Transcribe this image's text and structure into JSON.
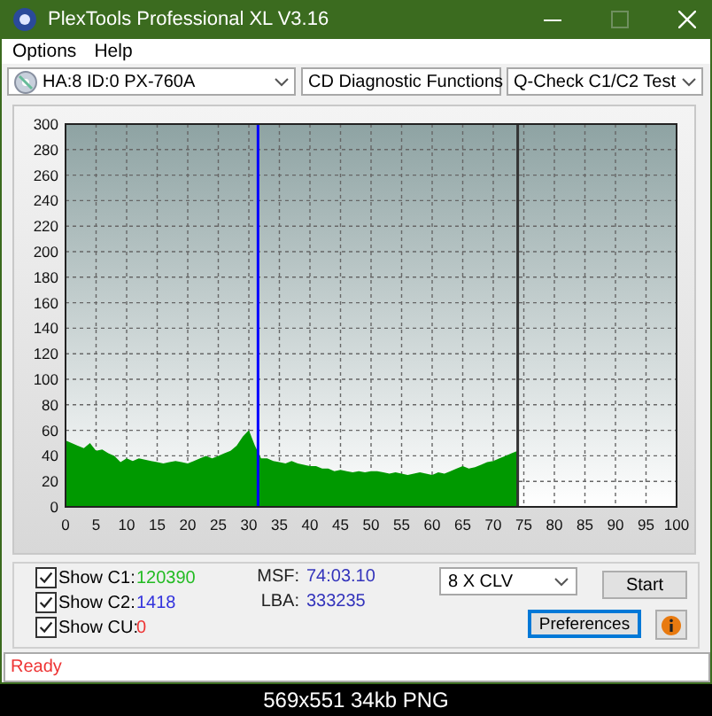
{
  "window": {
    "title": "PlexTools Professional XL V3.16"
  },
  "menu": [
    {
      "label": "Options"
    },
    {
      "label": "Help"
    }
  ],
  "toolbar": {
    "drive": "HA:8 ID:0  PX-760A",
    "function": "CD Diagnostic Functions",
    "test": "Q-Check C1/C2 Test"
  },
  "chart_data": {
    "type": "area",
    "x": [
      0,
      1,
      2,
      3,
      4,
      5,
      6,
      7,
      8,
      9,
      10,
      11,
      12,
      13,
      14,
      15,
      16,
      17,
      18,
      19,
      20,
      21,
      22,
      23,
      24,
      25,
      26,
      27,
      28,
      29,
      30,
      31,
      32,
      33,
      34,
      35,
      36,
      37,
      38,
      39,
      40,
      41,
      42,
      43,
      44,
      45,
      46,
      47,
      48,
      49,
      50,
      51,
      52,
      53,
      54,
      55,
      56,
      57,
      58,
      59,
      60,
      61,
      62,
      63,
      64,
      65,
      66,
      67,
      68,
      69,
      70,
      71,
      72,
      73,
      74
    ],
    "series": [
      {
        "color": "#009900",
        "values": [
          52,
          50,
          48,
          46,
          50,
          44,
          45,
          42,
          40,
          35,
          38,
          36,
          38,
          37,
          36,
          35,
          34,
          35,
          36,
          35,
          34,
          36,
          38,
          40,
          38,
          40,
          42,
          44,
          48,
          55,
          60,
          48,
          38,
          38,
          36,
          35,
          34,
          36,
          34,
          33,
          32,
          32,
          30,
          30,
          28,
          29,
          28,
          27,
          28,
          27,
          28,
          28,
          27,
          26,
          27,
          26,
          25,
          26,
          27,
          26,
          25,
          27,
          26,
          28,
          30,
          32,
          30,
          31,
          33,
          35,
          36,
          38,
          40,
          42,
          44
        ]
      }
    ],
    "xlim": [
      0,
      100
    ],
    "ylim": [
      0,
      300
    ],
    "xticks": [
      0,
      5,
      10,
      15,
      20,
      25,
      30,
      35,
      40,
      45,
      50,
      55,
      60,
      65,
      70,
      75,
      80,
      85,
      90,
      95,
      100
    ],
    "yticks": [
      0,
      20,
      40,
      60,
      80,
      100,
      120,
      140,
      160,
      180,
      200,
      220,
      240,
      260,
      280,
      300
    ],
    "grid": true,
    "ref_lines": [
      {
        "axis": "x",
        "value": 31.5,
        "color": "#0000ff"
      },
      {
        "axis": "x",
        "value": 74,
        "color": "#333333"
      }
    ]
  },
  "counters": [
    {
      "label": "Show C1:",
      "checked": true,
      "value": "120390",
      "color": "#22bb22"
    },
    {
      "label": "Show C2:",
      "checked": true,
      "value": "1418",
      "color": "#3333dd"
    },
    {
      "label": "Show CU:",
      "checked": true,
      "value": "0",
      "color": "#ee3333"
    }
  ],
  "position": [
    {
      "label": "MSF:",
      "value": "74:03.10"
    },
    {
      "label": "LBA:",
      "value": "333235"
    }
  ],
  "speed": "8 X CLV",
  "buttons": {
    "start": "Start",
    "preferences": "Preferences"
  },
  "status": "Ready",
  "image_caption": "569x551 34kb PNG"
}
